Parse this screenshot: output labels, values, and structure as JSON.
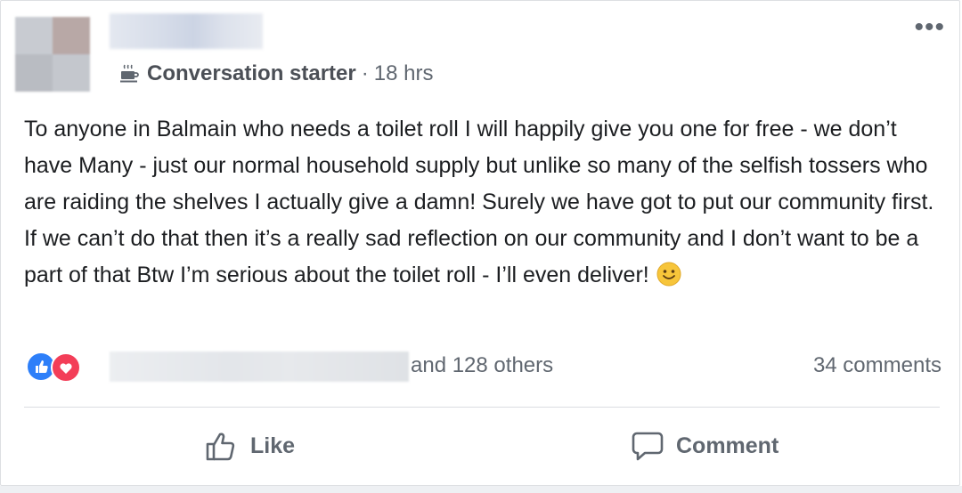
{
  "post": {
    "badge": "Conversation starter",
    "separator": "·",
    "time": "18 hrs",
    "menu": "•••",
    "text": "To anyone in Balmain who needs a toilet roll I will happily give you one for free - we don’t have Many - just our normal household supply but unlike so many of the selfish tossers who are raiding the shelves I actually give a damn! Surely we have got to put our community first. If we can’t do that then it’s a really sad reflection on our community and I don’t want to be a part of that Btw I’m serious about the toilet roll - I’ll even deliver!"
  },
  "reactions": {
    "others": "and 128 others",
    "comments": "34 comments"
  },
  "actions": {
    "like": "Like",
    "comment": "Comment"
  },
  "colors": {
    "like_blue": "#2d7ff9",
    "love_red": "#f33e58",
    "secondary_text": "#606770"
  },
  "icons": {
    "badge": "coffee-cup-icon",
    "emoji": "smiley-icon",
    "like_action": "thumbs-up-icon",
    "comment_action": "speech-bubble-icon"
  }
}
